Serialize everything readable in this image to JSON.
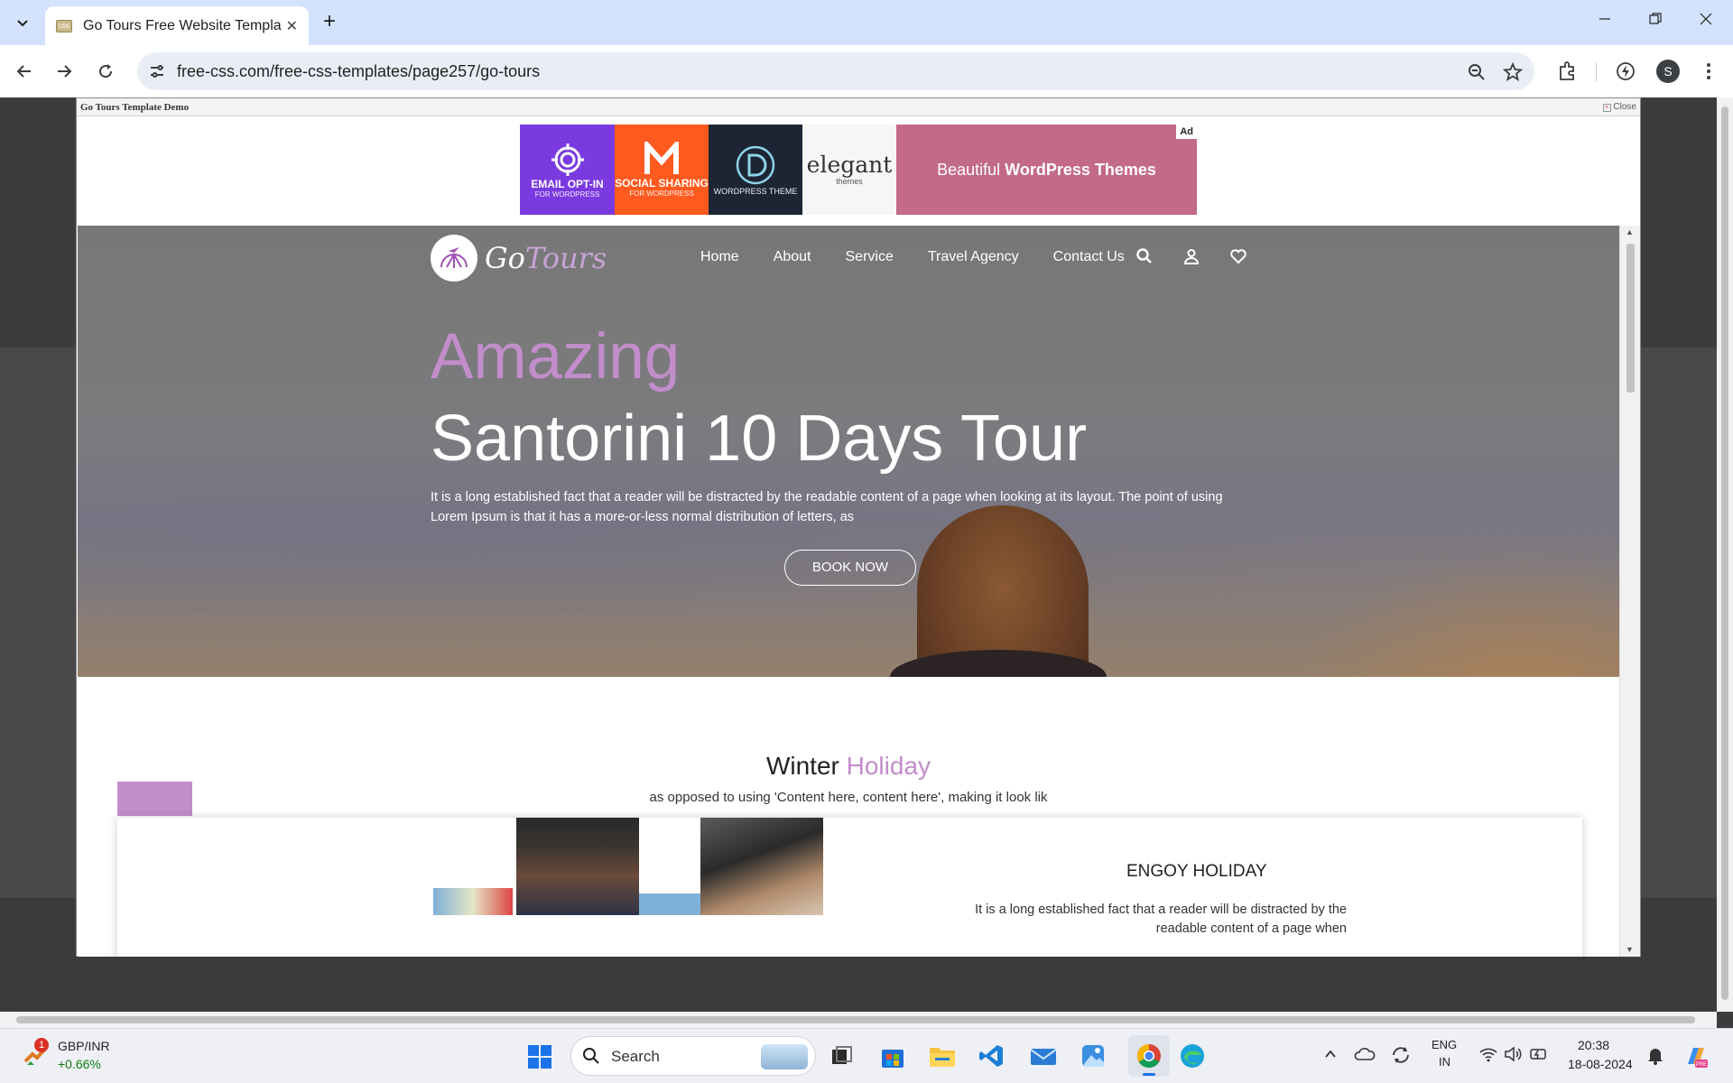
{
  "browser": {
    "tab_title": "Go Tours Free Website Templat",
    "url": "free-css.com/free-css-templates/page257/go-tours",
    "profile_initial": "S",
    "tab_close": "✕",
    "new_tab": "+"
  },
  "demo_bar": {
    "title": "Go Tours Template Demo",
    "close": "Close"
  },
  "ad": {
    "label": "Ad",
    "items": [
      {
        "big": "EMAIL OPT-IN",
        "small": "FOR WORDPRESS",
        "color": "#7b3ae0"
      },
      {
        "big": "SOCIAL SHARING",
        "small": "FOR WORDPRESS",
        "color": "#ff5a1f"
      },
      {
        "big": "WORDPRESS THEME",
        "small": "",
        "color": "#1d2535"
      },
      {
        "big": "elegant",
        "small": "themes",
        "color": "#f6f6f6"
      }
    ],
    "banner_prefix": "Beautiful ",
    "banner_bold": "WordPress Themes",
    "banner_color": "#c26a86"
  },
  "site": {
    "logo_go": "Go",
    "logo_tours": "Tours",
    "nav": [
      "Home",
      "About",
      "Service",
      "Travel Agency",
      "Contact Us"
    ],
    "hero_amazing": "Amazing",
    "hero_title": "Santorini 10 Days Tour",
    "hero_text": "It is a long established fact that a reader will be distracted by the readable content of a page when looking at its layout. The point of using Lorem Ipsum is that it has a more-or-less normal distribution of letters, as",
    "book_now": "BOOK NOW",
    "section_title_a": "Winter ",
    "section_title_b": "Holiday",
    "section_sub": "as opposed to using 'Content here, content here', making it look lik",
    "engoy_title": "ENGOY HOLIDAY",
    "engoy_text": "It is a long established fact that a reader will be distracted by the readable content of a page when",
    "accent": "#c28dca"
  },
  "taskbar": {
    "ticker": "GBP/INR",
    "ticker_change": "+0.66%",
    "badge": "1",
    "search": "Search",
    "lang_1": "ENG",
    "lang_2": "IN",
    "time": "20:38",
    "date": "18-08-2024"
  }
}
